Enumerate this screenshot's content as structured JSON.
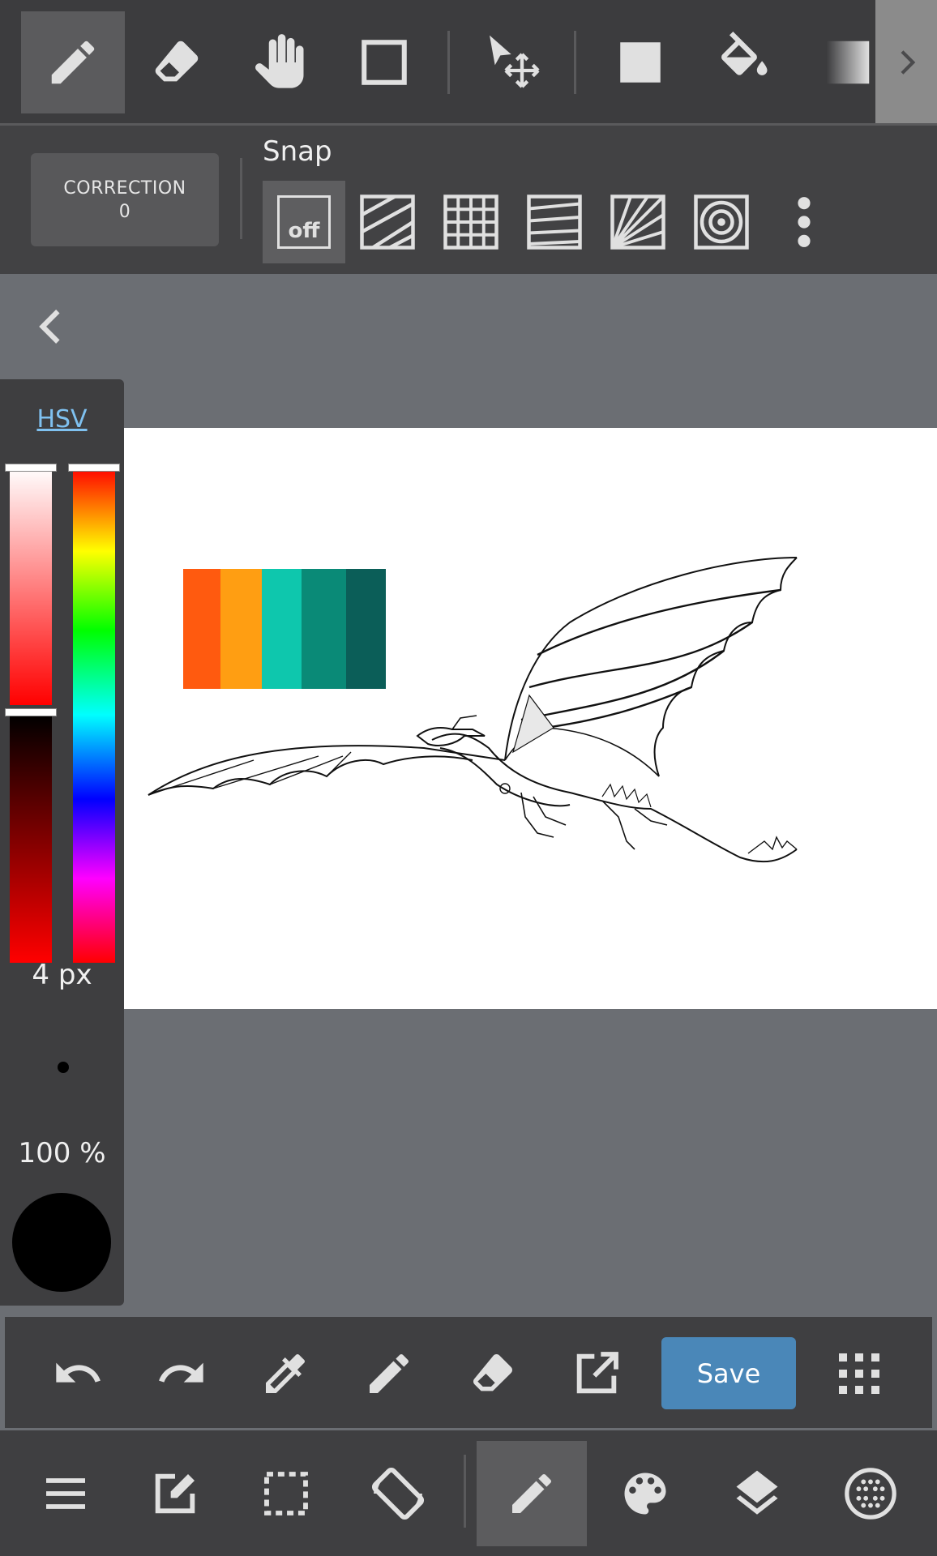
{
  "top_toolbar": {
    "tools": [
      {
        "name": "pen-tool-button",
        "icon": "pencil-icon",
        "active": true
      },
      {
        "name": "eraser-tool-button",
        "icon": "eraser-icon",
        "active": false
      },
      {
        "name": "hand-tool-button",
        "icon": "hand-icon",
        "active": false
      },
      {
        "name": "select-rect-button",
        "icon": "square-outline-icon",
        "active": false
      },
      {
        "name": "move-tool-button",
        "icon": "move-arrow-icon",
        "active": false
      },
      {
        "name": "fill-rect-button",
        "icon": "filled-square-icon",
        "active": false
      },
      {
        "name": "bucket-tool-button",
        "icon": "paint-bucket-icon",
        "active": false
      },
      {
        "name": "gradient-tool-button",
        "icon": "gradient-icon",
        "active": false
      }
    ],
    "expand_icon": "chevron-right-icon"
  },
  "snap_bar": {
    "correction_label": "CORRECTION",
    "correction_value": "0",
    "snap_label": "Snap",
    "off_label": "off",
    "snap_options": [
      "off",
      "parallel",
      "grid",
      "vanishing-line",
      "radial",
      "concentric"
    ],
    "more_icon": "more-vertical-icon"
  },
  "color_panel": {
    "mode_label": "HSV",
    "brush_size": "4 px",
    "opacity": "100 %",
    "current_color": "#000000"
  },
  "palette_swatches": [
    "#ff5a0f",
    "#ff9e12",
    "#0ec7ad",
    "#0a8a77",
    "#0b5e58"
  ],
  "action_bar": {
    "save_label": "Save",
    "icons": [
      "undo-icon",
      "redo-icon",
      "eyedropper-icon",
      "pencil-icon",
      "eraser-icon",
      "export-icon",
      "grid-dots-icon"
    ]
  },
  "nav_bar": {
    "icons": [
      "menu-icon",
      "edit-icon",
      "selection-icon",
      "rotate-icon",
      "brush-icon",
      "palette-icon",
      "layers-icon",
      "material-icon"
    ],
    "active": "brush-icon"
  },
  "colors": {
    "toolbar_bg": "#3c3c3e",
    "canvas_area_bg": "#6b6e73",
    "accent": "#4a87b8"
  }
}
